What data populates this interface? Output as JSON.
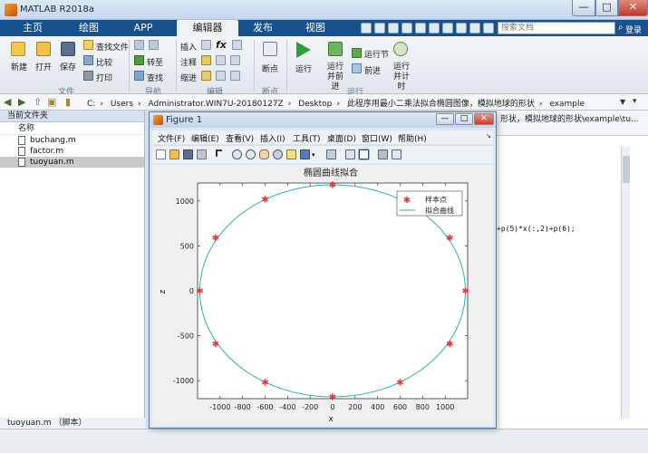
{
  "app": {
    "title": "MATLAB R2018a",
    "window_buttons": {
      "minimize": "—",
      "maximize": "□",
      "close": "✕"
    }
  },
  "tabs": [
    {
      "label": "主页"
    },
    {
      "label": "绘图"
    },
    {
      "label": "APP"
    },
    {
      "label": "编辑器"
    },
    {
      "label": "发布"
    },
    {
      "label": "视图"
    }
  ],
  "search": {
    "placeholder": "搜索文档"
  },
  "login": "登录",
  "ribbon": {
    "file_group": {
      "new": "新建",
      "open": "打开",
      "save": "保存",
      "find_files": "查找文件",
      "compare": "比较",
      "print": "打印",
      "label": "文件"
    },
    "nav_group": {
      "goto": "转至",
      "find": "查找",
      "label": "导航"
    },
    "edit_group": {
      "insert": "插入",
      "comment": "注释",
      "indent": "缩进",
      "fx": "fx",
      "label": "编辑"
    },
    "breakpoint_group": {
      "breakpoints": "断点",
      "label": "断点"
    },
    "run_group": {
      "run": "运行",
      "run_advance": "运行并前进",
      "run_section": "运行节",
      "advance": "前进",
      "run_time": "运行并计时",
      "label": "运行"
    }
  },
  "address": {
    "segments": [
      "C:",
      "Users",
      "Administrator.WIN7U-20180127Z",
      "Desktop",
      "此程序用最小二乘法拟合椭圆图像，模拟地球的形状",
      "example"
    ]
  },
  "folder_panel": {
    "header": "当前文件夹",
    "column_name": "名称",
    "files": [
      {
        "name": "buchang.m",
        "selected": false
      },
      {
        "name": "factor.m",
        "selected": false
      },
      {
        "name": "tuoyuan.m",
        "selected": true
      }
    ],
    "status": "tuoyuan.m （脚本）"
  },
  "editor": {
    "path_fragment": "形状，模拟地球的形状\\example\\tu...",
    "code_fragment": "+p(5)*x(:,2)+p(6);"
  },
  "figure": {
    "title": "Figure 1",
    "menu": [
      "文件(F)",
      "编辑(E)",
      "查看(V)",
      "插入(I)",
      "工具(T)",
      "桌面(D)",
      "窗口(W)",
      "帮助(H)"
    ]
  },
  "chart_data": {
    "type": "scatter",
    "title": "椭圆曲线拟合",
    "xlabel": "x",
    "ylabel": "z",
    "xlim": [
      -1200,
      1200
    ],
    "ylim": [
      -1200,
      1200
    ],
    "xticks": [
      -1000,
      -800,
      -600,
      -400,
      -200,
      0,
      200,
      400,
      600,
      800,
      1000
    ],
    "yticks": [
      -1000,
      -500,
      0,
      500,
      1000
    ],
    "legend_position": "top-right",
    "series": [
      {
        "name": "样本点",
        "marker": "star",
        "color": "#e8343a",
        "x": [
          1180,
          1040,
          600,
          0,
          -600,
          -1040,
          -1180,
          -1040,
          -600,
          0,
          600,
          1040
        ],
        "y": [
          0,
          590,
          1020,
          1180,
          1020,
          590,
          0,
          -590,
          -1020,
          -1180,
          -1020,
          -590
        ]
      },
      {
        "name": "拟合曲线",
        "type": "ellipse",
        "color": "#23b5ae",
        "center": [
          0,
          0
        ],
        "a": 1180,
        "b": 1180
      }
    ]
  }
}
